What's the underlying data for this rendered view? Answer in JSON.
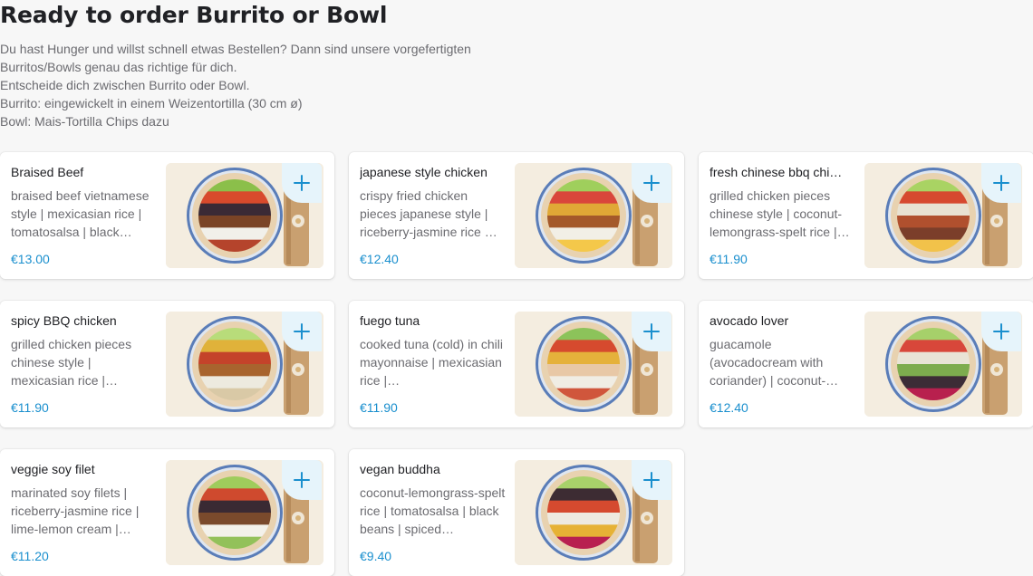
{
  "section": {
    "title": "Ready to order Burrito or Bowl",
    "description_lines": [
      "Du hast Hunger und willst schnell etwas Bestellen? Dann sind unsere vorgefertigten",
      "Burritos/Bowls genau das richtige für dich.",
      "Entscheide dich zwischen Burrito oder Bowl.",
      "Burrito: eingewickelt in einem Weizentortilla (30 cm ø)",
      "Bowl: Mais-Tortilla Chips dazu"
    ]
  },
  "colors": {
    "price": "#1a8fce",
    "add_button_bg": "#e6f4fb",
    "add_button_icon": "#1a8fce"
  },
  "items": [
    {
      "name": "Braised Beef",
      "description": "braised beef vietnamese style | mexicasian rice | tomatosalsa | black…",
      "price": "€13.00",
      "add_icon": "plus-icon",
      "stripes": [
        "#8bbf4a",
        "#d84a2c",
        "#3a2a35",
        "#7a4426",
        "#f1f0ea",
        "#b5442c"
      ]
    },
    {
      "name": "japanese style chicken",
      "description": "crispy fried chicken pieces japanese style | riceberry-jasmine rice …",
      "price": "€12.40",
      "add_icon": "plus-icon",
      "stripes": [
        "#9fcf5c",
        "#d9463b",
        "#e0a836",
        "#a4592a",
        "#f2efe6",
        "#f4c84a"
      ]
    },
    {
      "name": "fresh chinese bbq chi…",
      "description": "grilled chicken pieces chinese style | coconut-lemongrass-spelt rice |…",
      "price": "€11.90",
      "add_icon": "plus-icon",
      "stripes": [
        "#a9d363",
        "#d6492f",
        "#e8e2d2",
        "#b0502e",
        "#7b3e2a",
        "#f2c24a"
      ]
    },
    {
      "name": "spicy BBQ chicken",
      "description": "grilled chicken pieces chinese style | mexicasian rice |…",
      "price": "€11.90",
      "add_icon": "plus-icon",
      "stripes": [
        "#b8dc7a",
        "#e0b23a",
        "#c4432a",
        "#a8642e",
        "#edeadf",
        "#d9c9a6"
      ]
    },
    {
      "name": "fuego tuna",
      "description": "cooked tuna (cold) in chili mayonnaise | mexicasian rice |…",
      "price": "€11.90",
      "add_icon": "plus-icon",
      "stripes": [
        "#8cc35a",
        "#d64a2e",
        "#e5b13b",
        "#e8c8a6",
        "#f0ede4",
        "#d0563c"
      ]
    },
    {
      "name": "avocado lover",
      "description": "guacamole (avocadocream with coriander) | coconut-…",
      "price": "€12.40",
      "add_icon": "plus-icon",
      "stripes": [
        "#a6d06a",
        "#d8473a",
        "#e9e4d6",
        "#7dac4e",
        "#3c2c36",
        "#b8204e"
      ]
    },
    {
      "name": "veggie soy filet",
      "description": "marinated soy filets | riceberry-jasmine rice | lime-lemon cream |…",
      "price": "€11.20",
      "add_icon": "plus-icon",
      "stripes": [
        "#9fcc5c",
        "#cf4a2e",
        "#3a2a33",
        "#7a4a2c",
        "#f3f1ea",
        "#93c15a"
      ]
    },
    {
      "name": "vegan buddha",
      "description": "coconut-lemongrass-spelt rice | tomatosalsa | black beans | spiced…",
      "price": "€9.40",
      "add_icon": "plus-icon",
      "stripes": [
        "#a8d26a",
        "#3d2c33",
        "#d54a2f",
        "#eeeae0",
        "#e6b235",
        "#b82050"
      ]
    }
  ]
}
